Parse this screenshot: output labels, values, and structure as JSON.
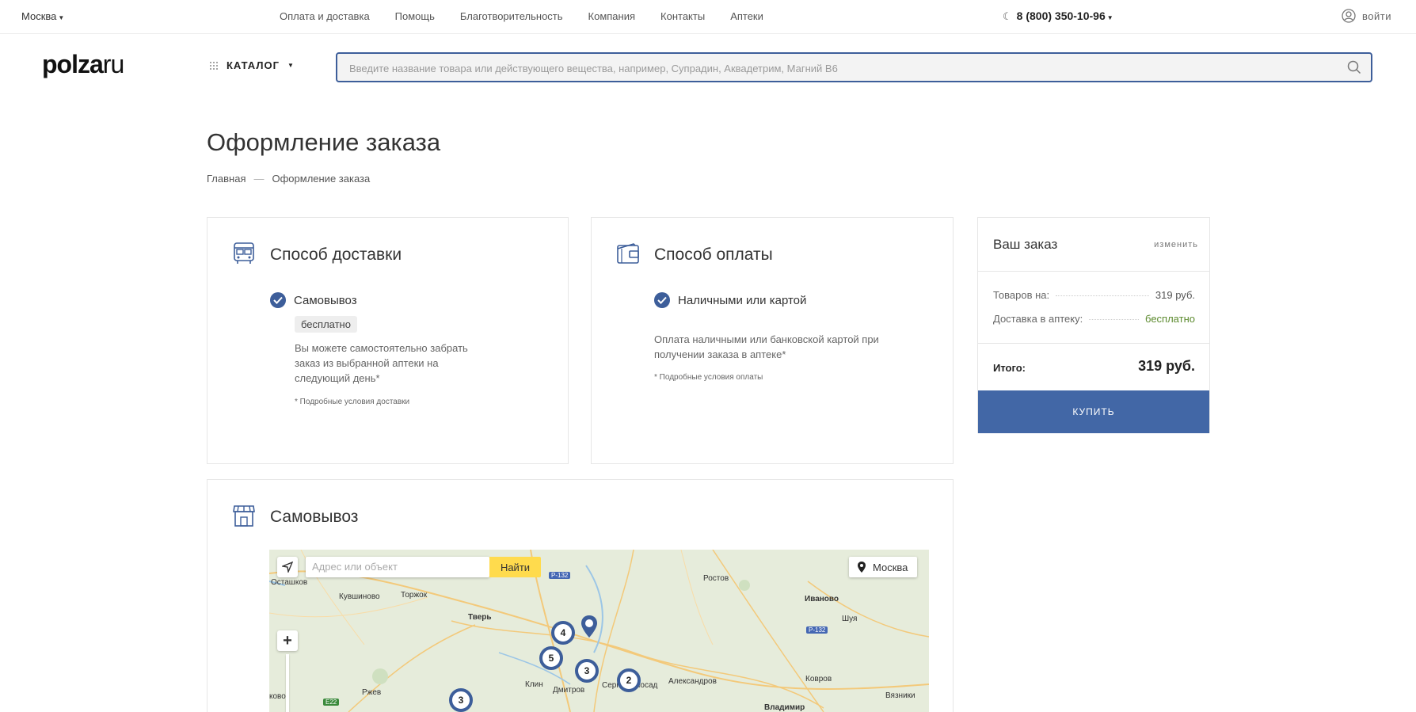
{
  "topbar": {
    "city": "Москва",
    "nav": [
      "Оплата и доставка",
      "Помощь",
      "Благотворительность",
      "Компания",
      "Контакты",
      "Аптеки"
    ],
    "phone": "8 (800) 350-10-96",
    "login": "войти"
  },
  "header": {
    "logo_main": "polza",
    "logo_suffix": "ru",
    "catalog": "КАТАЛОГ",
    "search_placeholder": "Введите название товара или действующего вещества, например, Супрадин, Аквадетрим, Магний B6"
  },
  "page": {
    "title": "Оформление заказа",
    "breadcrumb": [
      "Главная",
      "—",
      "Оформление заказа"
    ]
  },
  "delivery": {
    "title": "Способ доставки",
    "option": "Самовывоз",
    "tag": "бесплатно",
    "description_lines": [
      "Вы можете самостоятельно забрать",
      "заказ из выбранной аптеки на",
      "следующий день*"
    ],
    "note": "* Подробные условия доставки"
  },
  "payment": {
    "title": "Способ оплаты",
    "option": "Наличными или картой",
    "description_lines": [
      "Оплата наличными или банковской картой при",
      "получении заказа в аптеке*"
    ],
    "note": "* Подробные условия оплаты"
  },
  "pickup": {
    "title": "Самовывоз"
  },
  "map": {
    "search_placeholder": "Адрес или объект",
    "find_button": "Найти",
    "city": "Москва",
    "labels": [
      "Осташков",
      "Кувшиново",
      "Торжок",
      "Тверь",
      "Ростов",
      "Иваново",
      "Шуя",
      "Клин",
      "Дмитров",
      "Сергиев Посад",
      "Александров",
      "Ковров",
      "Ржев",
      "Владимир",
      "Вязники",
      "ково"
    ],
    "roads": [
      "Р-132",
      "Р-132",
      "E22"
    ],
    "clusters": [
      "4",
      "5",
      "3",
      "2",
      "3"
    ]
  },
  "summary": {
    "title": "Ваш заказ",
    "edit": "изменить",
    "goods_label": "Товаров на:",
    "goods_value": "319 руб.",
    "delivery_label": "Доставка в аптеку:",
    "delivery_value": "бесплатно",
    "total_label": "Итого:",
    "total_value": "319 руб.",
    "buy_button": "КУПИТЬ"
  }
}
